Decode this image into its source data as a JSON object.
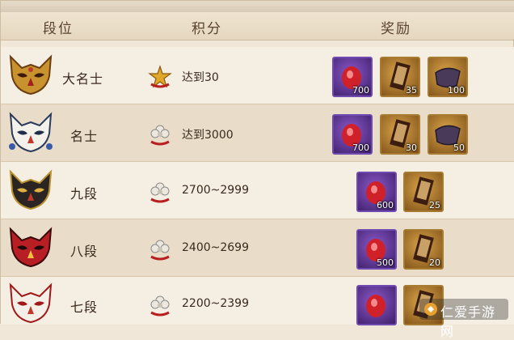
{
  "header": {
    "rank": "段位",
    "score": "积分",
    "reward": "奖励"
  },
  "rows": [
    {
      "name": "大名士",
      "score": "达到30",
      "rewards": [
        {
          "kind": "purple-gourd-icon",
          "count": "700"
        },
        {
          "kind": "scroll-icon",
          "count": "35"
        },
        {
          "kind": "cloth-icon",
          "count": "100"
        }
      ]
    },
    {
      "name": "名士",
      "score": "达到3000",
      "rewards": [
        {
          "kind": "purple-gourd-icon",
          "count": "700"
        },
        {
          "kind": "scroll-icon",
          "count": "30"
        },
        {
          "kind": "cloth-icon",
          "count": "50"
        }
      ]
    },
    {
      "name": "九段",
      "score": "2700~2999",
      "rewards": [
        {
          "kind": "purple-gourd-icon",
          "count": "600"
        },
        {
          "kind": "scroll-icon",
          "count": "25"
        }
      ]
    },
    {
      "name": "八段",
      "score": "2400~2699",
      "rewards": [
        {
          "kind": "purple-gourd-icon",
          "count": "500"
        },
        {
          "kind": "scroll-icon",
          "count": "20"
        }
      ]
    },
    {
      "name": "七段",
      "score": "2200~2399",
      "rewards": [
        {
          "kind": "purple-gourd-icon",
          "count": ""
        },
        {
          "kind": "scroll-icon",
          "count": ""
        }
      ]
    }
  ],
  "watermark": "仁爱手游网",
  "colors": {
    "row_light": "#f5eee2",
    "row_dark": "#e9ddc9",
    "header": "#e5d7bf",
    "purple_tile": "#5b2f96",
    "gold_tile": "#a87b32"
  }
}
